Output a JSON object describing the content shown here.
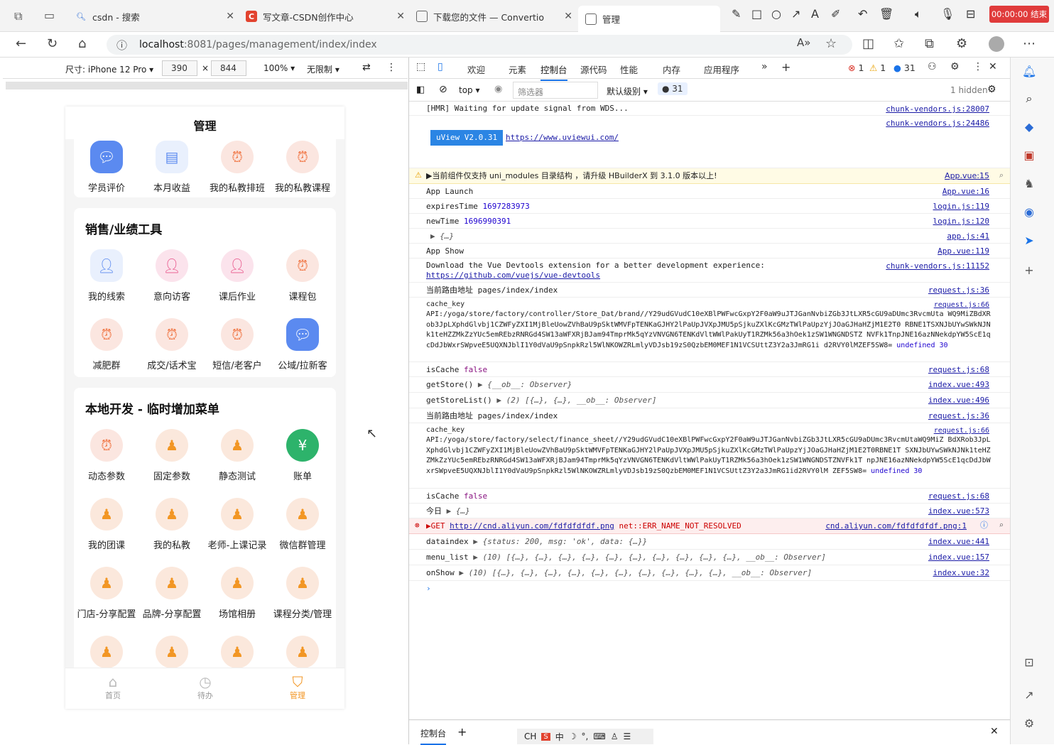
{
  "browser": {
    "tabs": [
      {
        "title": "csdn - 搜索",
        "icon": "search-icon"
      },
      {
        "title": "写文章-CSDN创作中心",
        "icon": "csdn-icon"
      },
      {
        "title": "下载您的文件 — Convertio",
        "icon": "page-icon"
      },
      {
        "title": "管理",
        "icon": "page-icon"
      }
    ],
    "record_label": "00:00:00 结束",
    "url_host": "localhost",
    "url_path": ":8081/pages/management/index/index"
  },
  "device_toolbar": {
    "device_label": "尺寸: iPhone 12 Pro",
    "width": "390",
    "height": "844",
    "times": "×",
    "zoom": "100%",
    "throttle": "无限制"
  },
  "phone": {
    "title": "管理",
    "top_items": [
      "学员评价",
      "本月收益",
      "我的私教排班",
      "我的私教课程"
    ],
    "section1": {
      "title": "销售/业绩工具",
      "items": [
        "我的线索",
        "意向访客",
        "课后作业",
        "课程包",
        "减肥群",
        "成交/话术宝",
        "短信/老客户",
        "公域/拉新客"
      ]
    },
    "section2": {
      "title": "本地开发 - 临时增加菜单",
      "items": [
        "动态参数",
        "固定参数",
        "静态测试",
        "账单",
        "我的团课",
        "我的私教",
        "老师-上课记录",
        "微信群管理",
        "门店-分享配置",
        "品牌-分享配置",
        "场馆相册",
        "课程分类/管理"
      ]
    },
    "bottom_tabs": [
      {
        "label": "首页",
        "icon": "home-icon",
        "active": false
      },
      {
        "label": "待办",
        "icon": "clock-icon",
        "active": false
      },
      {
        "label": "管理",
        "icon": "shield-icon",
        "active": true
      }
    ]
  },
  "devtools": {
    "tabs": [
      "欢迎",
      "元素",
      "控制台",
      "源代码",
      "性能",
      "内存",
      "应用程序"
    ],
    "active_tab": "控制台",
    "errors": "1",
    "warnings": "1",
    "messages": "31",
    "context": "top",
    "filter_placeholder": "筛选器",
    "level": "默认级别",
    "level_count": "31",
    "hidden": "1 hidden",
    "drawer_tab": "控制台",
    "console": [
      {
        "text": "[HMR] Waiting for update signal from WDS...",
        "src": "chunk-vendors.js:28007"
      },
      {
        "badge": "uView V2.0.31",
        "link": "https://www.uviewui.com/",
        "src": "chunk-vendors.js:24486"
      },
      {
        "text": "▶当前组件仅支持 uni_modules 目录结构 ，请升级 HBuilderX 到 3.1.0 版本以上!",
        "src": "App.vue:15"
      },
      {
        "text": "App Launch",
        "src": "App.vue:16"
      },
      {
        "text": "expiresTime",
        "value": "1697283973",
        "src": "login.js:119"
      },
      {
        "text": "newTime",
        "value": "1696990391",
        "src": "login.js:120"
      },
      {
        "text": "▶ {…}",
        "src": "app.js:41"
      },
      {
        "text": "App Show",
        "src": "App.vue:119"
      },
      {
        "text": "Download the Vue Devtools extension for a better development experience:",
        "link": "https://github.com/vuejs/vue-devtools",
        "src": "chunk-vendors.js:11152"
      },
      {
        "text": "当前路由地址 pages/index/index",
        "src": "request.js:36"
      },
      {
        "text": "cache_key",
        "body": "API:/yoga/store/factory/controller/Store_Dat/brand//Y29udGVudC10eXBlPWFwcGxpY2F0aW9uJTJGanNvbiZGb3JtLXR5cGU9aDUmc3RvcmUta WQ9MiZBdXRob3JpLXphdGlvbj1CZWFyZXI1MjBleUowZVhBaU9pSktWMVFpTENKaGJHY2lPaUpJVXpJMU5pSjkuZXlKcGMzTWlPaUpzYjJOaGJHaHZjM1E2T0 RBNE1TSXNJbUYwSWkNJNk1teHZZMkZzYUc5emREbzRNRGd4SW13aWFXRjBJam94TmprMk5qYzVNVGN6TENKdVltWWlPakUyT1RZMk56a3hOek1zSW1WNGNDSTZ NVFk1TnpJNE16azNNekdpYW5ScE1qcDdJbWxrSWpveE5UQXNJblI1Y0dVaU9pSnpkRzl5WlNKOWZRLmlyVDJsb19zS0QzbEM0MEF1N1VCSUttZ3Y2a3JmRG1i d2RVY0lMZEF5SW8=",
        "tail": "undefined 30",
        "src": "request.js:66"
      },
      {
        "text": "isCache",
        "kwv": "false",
        "src": "request.js:68"
      },
      {
        "text": "getStore()",
        "it": "▶ {__ob__: Observer}",
        "src": "index.vue:493"
      },
      {
        "text": "getStoreList()",
        "it": "▶ (2) [{…}, {…}, __ob__: Observer]",
        "src": "index.vue:496"
      },
      {
        "text": "当前路由地址 pages/index/index",
        "src": "request.js:36"
      },
      {
        "text": "cache_key",
        "body": "API:/yoga/store/factory/select/finance_sheet//Y29udGVudC10eXBlPWFwcGxpY2F0aW9uJTJGanNvbiZGb3JtLXR5cGU9aDUmc3RvcmUtaWQ9MiZ BdXRob3JpLXphdGlvbj1CZWFyZXI1MjBleUowZVhBaU9pSktWMVFpTENKaGJHY2lPaUpJVXpJMU5pSjkuZXlKcGMzTWlPaUpzYjJOaGJHaHZjM1E2T0RBNE1T SXNJbUYwSWkNJNk1teHZZMkZzYUc5emREbzRNRGd4SW13aWFXRjBJam94TmprMk5qYzVNVGN6TENKdVltWWlPakUyT1RZMk56a3hOek1zSW1WNGNDSTZNVFk1T npJNE16azNNekdpYW5ScE1qcDdJbWxrSWpveE5UQXNJblI1Y0dVaU9pSnpkRzl5WlNKOWZRLmlyVDJsb19zS0QzbEM0MEF1N1VCSUttZ3Y2a3JmRG1id2RVY0lM ZEF5SW8=",
        "tail": "undefined 30",
        "src": "request.js:66"
      },
      {
        "text": "isCache",
        "kwv": "false",
        "src": "request.js:68"
      },
      {
        "text": "今日",
        "it": "▶ {…}",
        "src": "index.vue:573"
      },
      {
        "text": "▶GET",
        "link": "http://cnd.aliyun.com/fdfdfdfdf.png",
        "tail": "net::ERR_NAME_NOT_RESOLVED",
        "src": "cnd.aliyun.com/fdfdfdfdf.png:1"
      },
      {
        "text": "dataindex",
        "it": "▶ {status: 200, msg: 'ok', data: {…}}",
        "src": "index.vue:441"
      },
      {
        "text": "menu_list",
        "it": "▶ (10) [{…}, {…}, {…}, {…}, {…}, {…}, {…}, {…}, {…}, {…}, __ob__: Observer]",
        "src": "index.vue:157"
      },
      {
        "text": "onShow",
        "it": "▶ (10) [{…}, {…}, {…}, {…}, {…}, {…}, {…}, {…}, {…}, {…}, __ob__: Observer]",
        "src": "index.vue:32"
      }
    ],
    "prompt": "›"
  },
  "taskbar": {
    "ime": "CH",
    "mode": "中"
  }
}
